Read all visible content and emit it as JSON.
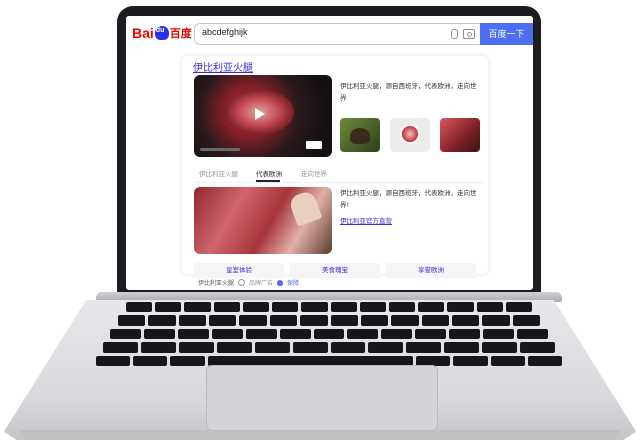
{
  "search": {
    "query": "abcdefghijk",
    "button_label": "百度一下"
  },
  "logo": {
    "text_left": "Bai",
    "text_right": "百度"
  },
  "result": {
    "title": "伊比利亚火腿",
    "description_top": "伊比利亚火腿，源自西班牙，代表欧洲，走向世界",
    "tabs": [
      {
        "label": "伊比利亚火腿",
        "active": false
      },
      {
        "label": "代表欧洲",
        "active": true
      },
      {
        "label": "走向世界",
        "active": false
      }
    ],
    "description_bottom": "伊比利亚火腿，源自西班牙，代表欧洲，走向世界!",
    "official_link": "伊比利亚官方直营",
    "buttons": [
      "皇室体验",
      "美食瑰宝",
      "享誉欧洲"
    ]
  },
  "footer": {
    "source": "伊比利亚火腿",
    "ad_label": "品牌广告",
    "verified_label": "保障"
  },
  "colors": {
    "search_button": "#4e6ef2",
    "link": "#3b2bd6",
    "brand_red": "#e10601"
  }
}
